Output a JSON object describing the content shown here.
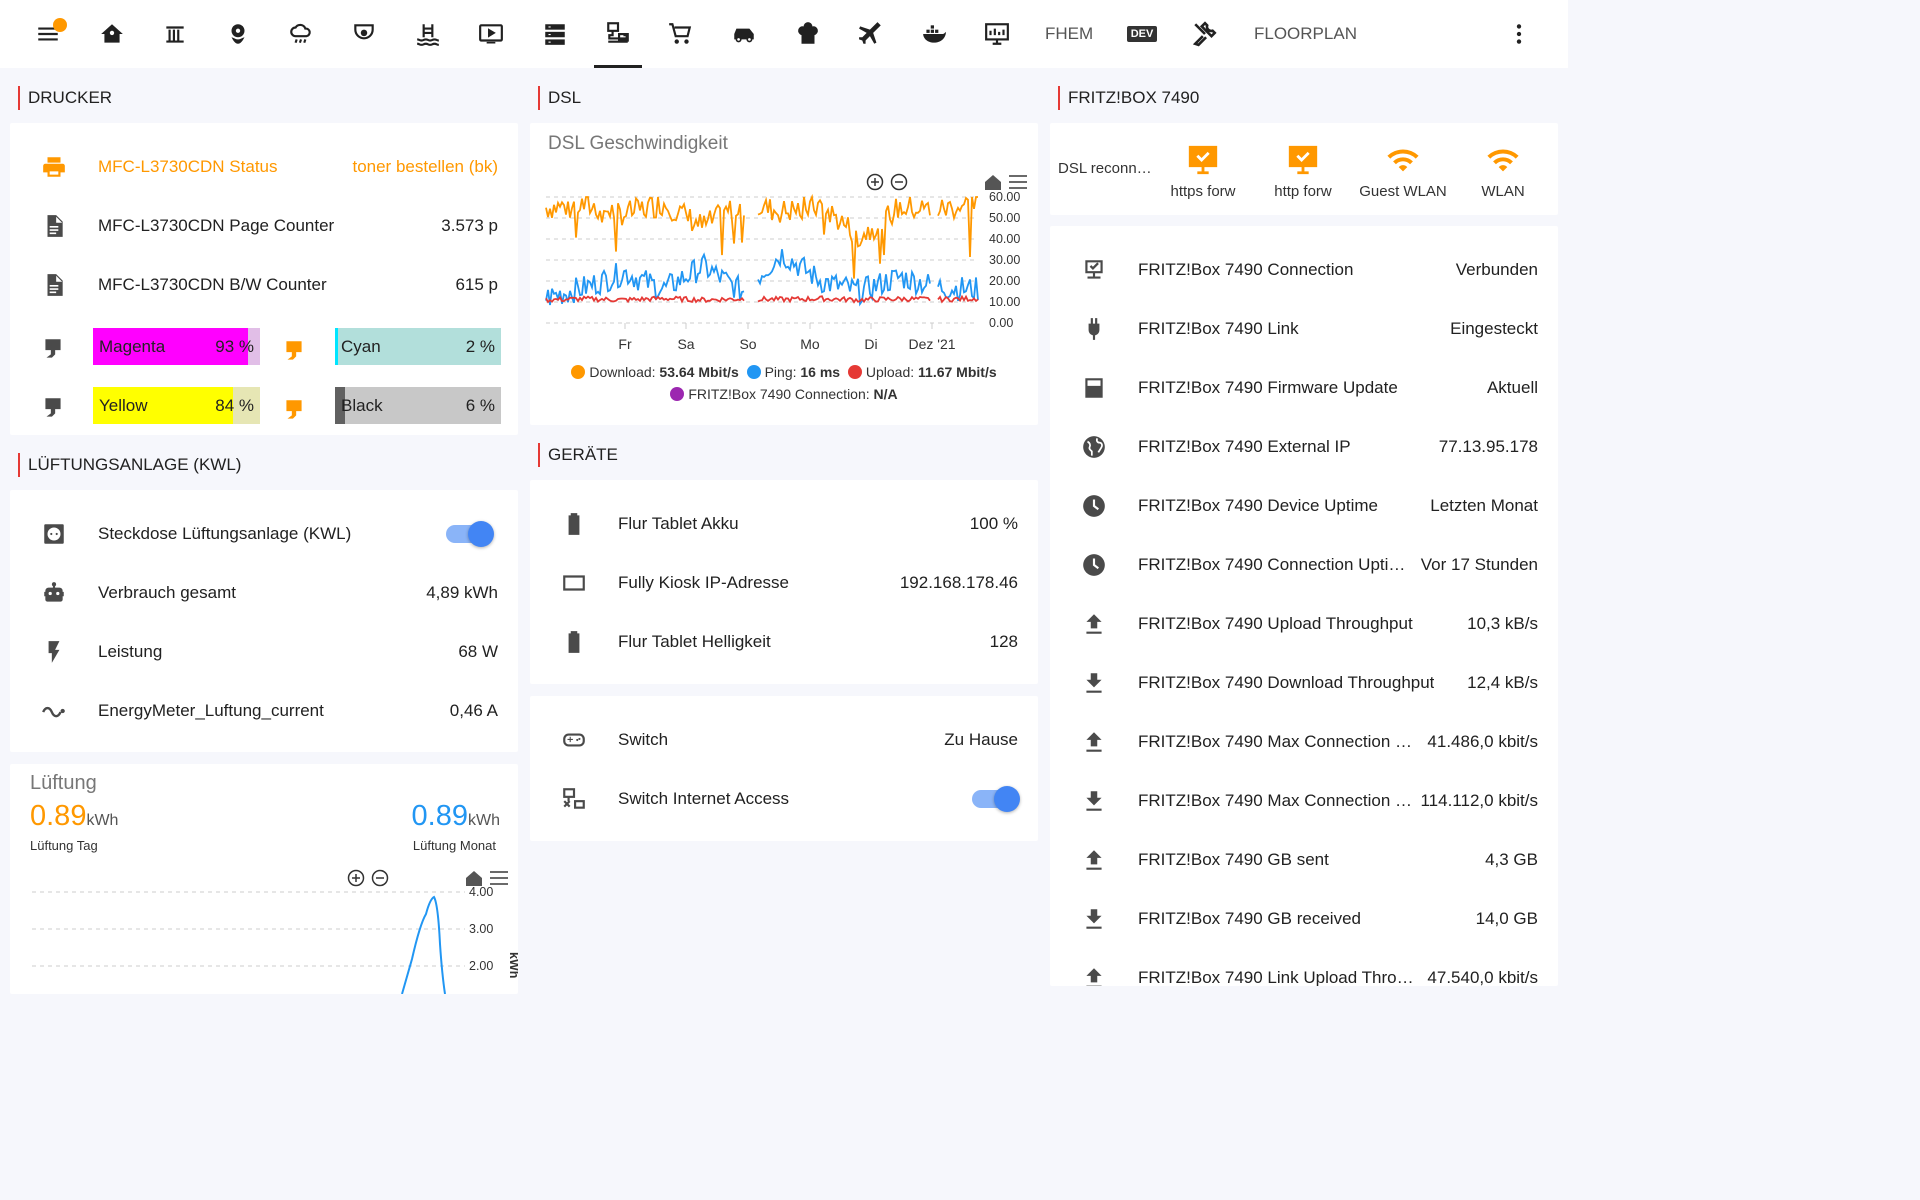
{
  "topbar": {
    "tabs": [
      {
        "name": "menu-icon"
      },
      {
        "name": "home-icon"
      },
      {
        "name": "radiator-icon"
      },
      {
        "name": "flower-icon"
      },
      {
        "name": "weather-icon"
      },
      {
        "name": "camera-icon"
      },
      {
        "name": "pool-icon"
      },
      {
        "name": "media-icon"
      },
      {
        "name": "server-icon"
      },
      {
        "name": "network-icon"
      },
      {
        "name": "cart-icon"
      },
      {
        "name": "car-icon"
      },
      {
        "name": "chef-icon"
      },
      {
        "name": "airplane-icon"
      },
      {
        "name": "docker-icon"
      },
      {
        "name": "monitor-icon"
      }
    ],
    "fhem_label": "FHEM",
    "dev_label": "DEV",
    "floorplan_label": "FLOORPLAN"
  },
  "colors": {
    "accent": "#ff9800",
    "blue": "#2196f3",
    "red": "#e53935",
    "purple": "#9c27b0",
    "magenta": "#ff00ff",
    "cyan": "#b2dfdb",
    "yellow": "#ffff00",
    "black": "#c8c8c8"
  },
  "drucker": {
    "title": "DRUCKER",
    "status_label": "MFC-L3730CDN Status",
    "status_value": "toner bestellen (bk)",
    "page_counter_label": "MFC-L3730CDN Page Counter",
    "page_counter_value": "3.573 p",
    "bw_counter_label": "MFC-L3730CDN B/W Counter",
    "bw_counter_value": "615 p",
    "toner": [
      {
        "name": "Magenta",
        "pct_label": "93 %",
        "pct": 93
      },
      {
        "name": "Cyan",
        "pct_label": "2 %",
        "pct": 2
      },
      {
        "name": "Yellow",
        "pct_label": "84 %",
        "pct": 84
      },
      {
        "name": "Black",
        "pct_label": "6 %",
        "pct": 6
      }
    ]
  },
  "kwl": {
    "title": "LÜFTUNGSANLAGE (KWL)",
    "rows": [
      {
        "label": "Steckdose Lüftungsanlage (KWL)",
        "value": ""
      },
      {
        "label": "Verbrauch gesamt",
        "value": "4,89 kWh"
      },
      {
        "label": "Leistung",
        "value": "68 W"
      },
      {
        "label": "EnergyMeter_Luftung_current",
        "value": "0,46 A"
      }
    ]
  },
  "lueftung": {
    "title": "Lüftung",
    "day_value": "0.89",
    "day_unit": "kWh",
    "day_label": "Lüftung Tag",
    "month_value": "0.89",
    "month_unit": "kWh",
    "month_label": "Lüftung Monat",
    "y_ticks": [
      "4.00",
      "3.00",
      "2.00"
    ],
    "y_unit": "kWh"
  },
  "dsl": {
    "title": "DSL",
    "chart_title": "DSL Geschwindigkeit",
    "y_ticks": [
      "60.00",
      "50.00",
      "40.00",
      "30.00",
      "20.00",
      "10.00",
      "0.00"
    ],
    "x_ticks": [
      "Fr",
      "Sa",
      "So",
      "Mo",
      "Di",
      "Dez '21"
    ],
    "legend": [
      {
        "name": "Download:",
        "value": "53.64 Mbit/s"
      },
      {
        "name": "Ping:",
        "value": "16 ms"
      },
      {
        "name": "Upload:",
        "value": "11.67 Mbit/s"
      },
      {
        "name": "FRITZ!Box 7490 Connection:",
        "value": "N/A"
      }
    ]
  },
  "chart_data": {
    "type": "line",
    "title": "DSL Geschwindigkeit",
    "x": [
      "Fr",
      "Sa",
      "So",
      "Mo",
      "Di",
      "Dez '21"
    ],
    "ylim": [
      0,
      60
    ],
    "series": [
      {
        "name": "Download",
        "values": [
          55,
          56,
          52,
          57,
          46,
          57,
          53,
          56,
          41,
          55,
          54,
          57
        ]
      },
      {
        "name": "Ping",
        "values": [
          12,
          17,
          24,
          16,
          27,
          15,
          33,
          20,
          15,
          22,
          17,
          16
        ]
      },
      {
        "name": "Upload",
        "values": [
          11,
          11.5,
          11,
          11.7,
          11,
          11.5,
          11.2,
          11.6,
          11,
          11.5,
          11.2,
          11.67
        ]
      }
    ]
  },
  "geraete": {
    "title": "GERÄTE",
    "rows": [
      {
        "label": "Flur Tablet Akku",
        "value": "100 %"
      },
      {
        "label": "Fully Kiosk IP-Adresse",
        "value": "192.168.178.46"
      },
      {
        "label": "Flur Tablet Helligkeit",
        "value": "128"
      }
    ],
    "switch_rows": [
      {
        "label": "Switch",
        "value": "Zu Hause"
      },
      {
        "label": "Switch Internet Access",
        "value": ""
      }
    ]
  },
  "fritzbox": {
    "title": "FRITZ!BOX 7490",
    "reconnect_label": "DSL reconn…",
    "tiles": [
      {
        "label": "https forw"
      },
      {
        "label": "http forw"
      },
      {
        "label": "Guest WLAN"
      },
      {
        "label": "WLAN"
      }
    ],
    "rows": [
      {
        "label": "FRITZ!Box 7490 Connection",
        "value": "Verbunden"
      },
      {
        "label": "FRITZ!Box 7490 Link",
        "value": "Eingesteckt"
      },
      {
        "label": "FRITZ!Box 7490 Firmware Update",
        "value": "Aktuell"
      },
      {
        "label": "FRITZ!Box 7490 External IP",
        "value": "77.13.95.178"
      },
      {
        "label": "FRITZ!Box 7490 Device Uptime",
        "value": "Letzten Monat"
      },
      {
        "label": "FRITZ!Box 7490 Connection Upti…",
        "value": "Vor 17 Stunden"
      },
      {
        "label": "FRITZ!Box 7490 Upload Throughput",
        "value": "10,3 kB/s"
      },
      {
        "label": "FRITZ!Box 7490 Download Throughput",
        "value": "12,4 kB/s"
      },
      {
        "label": "FRITZ!Box 7490 Max Connection …",
        "value": "41.486,0 kbit/s"
      },
      {
        "label": "FRITZ!Box 7490 Max Connection …",
        "value": "114.112,0 kbit/s"
      },
      {
        "label": "FRITZ!Box 7490 GB sent",
        "value": "4,3 GB"
      },
      {
        "label": "FRITZ!Box 7490 GB received",
        "value": "14,0 GB"
      },
      {
        "label": "FRITZ!Box 7490 Link Upload Thro…",
        "value": "47.540,0 kbit/s"
      }
    ]
  }
}
